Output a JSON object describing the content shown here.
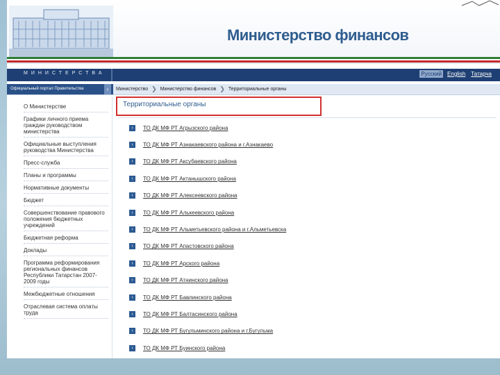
{
  "header": {
    "logo_title": "Министерство финансов"
  },
  "navbar": {
    "title": "МИНИСТЕРСТВА",
    "languages": [
      {
        "label": "Русский",
        "active": true
      },
      {
        "label": "English",
        "active": false
      },
      {
        "label": "Татарча",
        "active": false
      }
    ]
  },
  "subbar": {
    "left_label": "Официальный портал Правительства",
    "breadcrumb": [
      "Министерство",
      "Министерство финансов",
      "Территориальные органы"
    ]
  },
  "sidebar": {
    "items": [
      "О Министерстве",
      "Графики личного приема граждан руководством министерства",
      "Официальные выступления руководства Министерства",
      "Пресс-служба",
      "Планы и программы",
      "Нормативные документы",
      "Бюджет",
      "Совершенствование правового положения бюджетных учреждений",
      "Бюджетная реформа",
      "Доклады",
      "Программа реформирования региональных финансов Республики Татарстан 2007-2009 годы",
      "Межбюджетные отношения",
      "Отраслевая система оплаты труда"
    ]
  },
  "main": {
    "section_title": "Территориальные органы",
    "links": [
      "ТО ДК МФ РТ Агрызского района",
      "ТО ДК МФ РТ Азнакаевского района и г.Азнакаево",
      "ТО ДК МФ РТ Аксубаевского района",
      "ТО ДК МФ РТ Актанышского района",
      "ТО ДК МФ РТ Алексеевского района",
      "ТО ДК МФ РТ Алькеевского района",
      "ТО ДК МФ РТ Альметьевского района и г.Альметьевска",
      "ТО ДК МФ РТ Апастовского района",
      "ТО ДК МФ РТ Арского района",
      "ТО ДК МФ РТ Атнинского района",
      "ТО ДК МФ РТ Бавлинского района",
      "ТО ДК МФ РТ Балтасинского района",
      "ТО ДК МФ РТ Бугульминского района и г.Бугульма",
      "ТО ДК МФ РТ Буинского района"
    ]
  },
  "colors": {
    "brand_blue": "#2f5d8f",
    "nav_blue": "#1e3f73",
    "highlight_red": "#d32f2f"
  }
}
